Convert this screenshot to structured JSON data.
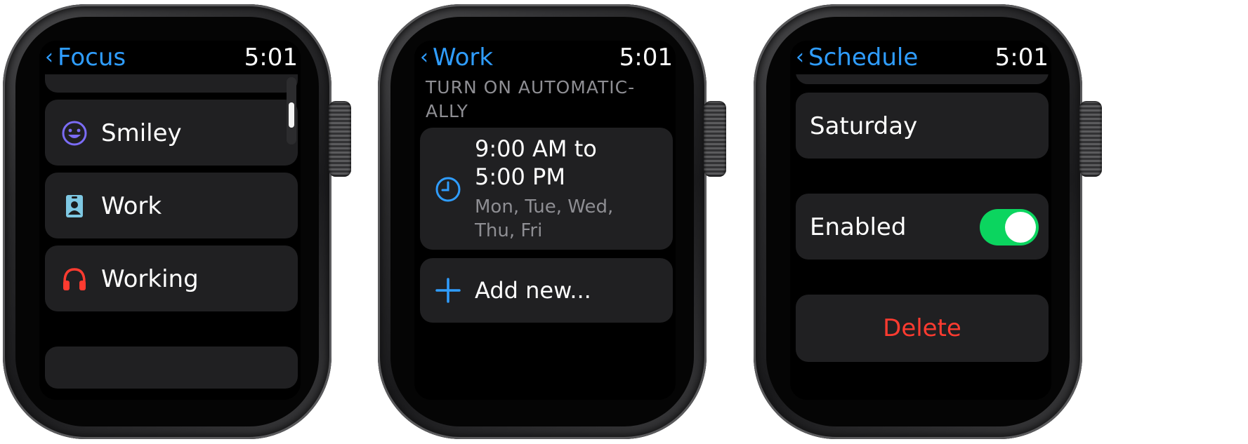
{
  "screens": [
    {
      "back_label": "Focus",
      "time": "5:01",
      "items": [
        {
          "label": "Smiley",
          "icon": "smiley-icon"
        },
        {
          "label": "Work",
          "icon": "work-badge-icon"
        },
        {
          "label": "Working",
          "icon": "headphones-icon"
        }
      ]
    },
    {
      "back_label": "Work",
      "time": "5:01",
      "section_title_line1": "TURN ON AUTOMATIC-",
      "section_title_line2": "ALLY",
      "schedule": {
        "time_line1": "9:00 AM to",
        "time_line2": "5:00 PM",
        "days_line1": "Mon, Tue, Wed,",
        "days_line2": "Thu, Fri",
        "icon": "clock-icon"
      },
      "add_new_label": "Add new...",
      "add_icon": "plus-icon"
    },
    {
      "back_label": "Schedule",
      "time": "5:01",
      "day_label": "Saturday",
      "enabled_label": "Enabled",
      "enabled": true,
      "delete_label": "Delete"
    }
  ],
  "colors": {
    "accent": "#2f9dff",
    "toggle_on": "#0bd55f",
    "destructive": "#ff3b30",
    "row_bg": "#202022",
    "secondary_text": "#8e8e93",
    "smiley": "#7b6cf6",
    "work_badge": "#7ec8e3",
    "headphones": "#ff3b30"
  }
}
